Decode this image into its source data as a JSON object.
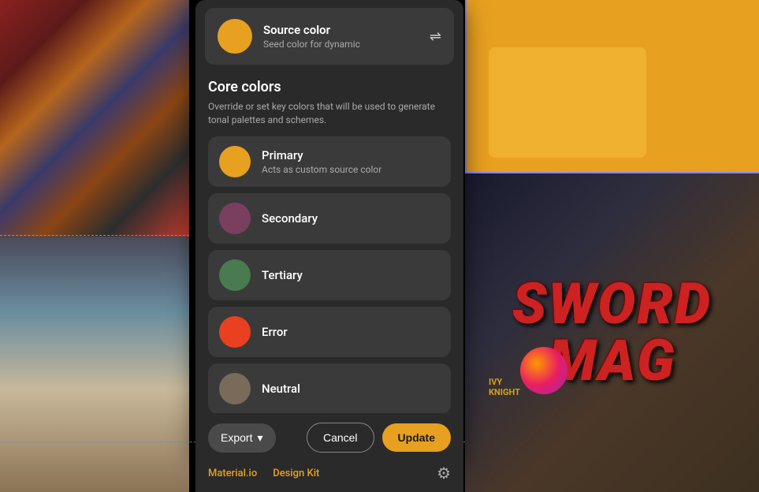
{
  "panel": {
    "source_color": {
      "title": "Source color",
      "subtitle": "Seed color for dynamic",
      "color": "#e8a020"
    },
    "core_section": {
      "title": "Core colors",
      "description": "Override or set key colors that will be used to generate tonal palettes and schemes."
    },
    "colors": [
      {
        "name": "Primary",
        "sublabel": "Acts as custom source color",
        "color": "#e8a020"
      },
      {
        "name": "Secondary",
        "sublabel": "",
        "color": "#7a3f5e"
      },
      {
        "name": "Tertiary",
        "sublabel": "",
        "color": "#4a7a50"
      },
      {
        "name": "Error",
        "sublabel": "",
        "color": "#e84020"
      },
      {
        "name": "Neutral",
        "sublabel": "",
        "color": "#7a6a5a"
      }
    ],
    "footer": {
      "export_label": "Export",
      "cancel_label": "Cancel",
      "update_label": "Update",
      "link1": "Material.io",
      "link2": "Design Kit"
    }
  }
}
